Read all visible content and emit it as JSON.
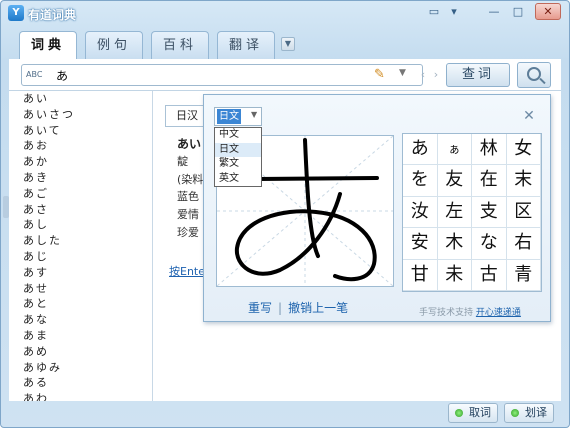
{
  "app": {
    "title": "有道词典",
    "icon_glyph": "Y",
    "icons": [
      "chat-icon",
      "skin-icon",
      "minimize-icon",
      "maximize-icon",
      "close-icon"
    ]
  },
  "tabs": [
    {
      "label": "词典",
      "active": true
    },
    {
      "label": "例句",
      "active": false
    },
    {
      "label": "百科",
      "active": false
    },
    {
      "label": "翻译",
      "active": false
    }
  ],
  "search": {
    "mode_label": "ABC",
    "value": "あ",
    "button_label": "查词"
  },
  "word_list": [
    "あい",
    "あいさつ",
    "あいて",
    "あお",
    "あか",
    "あき",
    "あご",
    "あさ",
    "あし",
    "あした",
    "あじ",
    "あす",
    "あせ",
    "あと",
    "あな",
    "あま",
    "あめ",
    "あゆみ",
    "ある",
    "あわ"
  ],
  "content": {
    "lang_tab": "日汉",
    "headword": "あい",
    "lines": [
      "靛",
      "(染料",
      "蓝色",
      "爱情",
      "珍爱"
    ],
    "enter_link": "按Ente"
  },
  "handwriting": {
    "lang_selected": "日文",
    "lang_options": [
      "中文",
      "日文",
      "繁文",
      "英文"
    ],
    "rewrite": "重写",
    "separator": "|",
    "undo": "撤销上一笔",
    "credit": "手写技术支持",
    "credit_link": "开心速递通",
    "candidates": [
      "あ",
      "ぁ",
      "林",
      "女",
      "を",
      "友",
      "在",
      "末",
      "汝",
      "左",
      "支",
      "区",
      "安",
      "木",
      "な",
      "右",
      "甘",
      "未",
      "古",
      "青"
    ]
  },
  "bottom": {
    "cancel_label": "取词",
    "translate_label": "划译"
  }
}
